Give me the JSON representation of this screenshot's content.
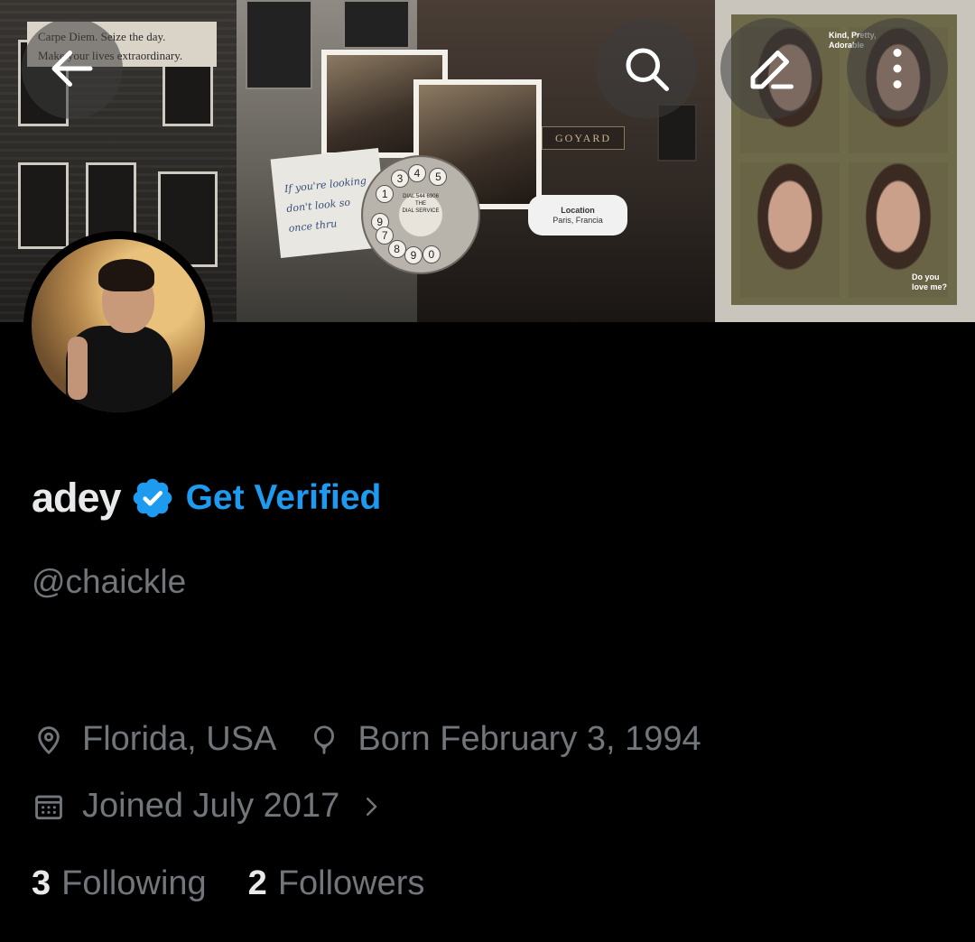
{
  "header": {
    "back_icon": "arrow-left-icon",
    "search_icon": "search-icon",
    "edit_icon": "pencil-icon",
    "more_icon": "more-vertical-icon"
  },
  "banner": {
    "quote_line1": "Carpe Diem. Seize the day.",
    "quote_line2": "Make your lives extraordinary.",
    "note_line1": "If you're looking",
    "note_line2": "don't look so",
    "note_line3": "once thru",
    "dial_text1": "DIAL 544 6906",
    "dial_text2": "THE",
    "dial_text3": "DIAL SERVICE",
    "dial_numbers": [
      "1",
      "3",
      "4",
      "5",
      "9",
      "7",
      "8",
      "9",
      "0"
    ],
    "store_sign": "GOYARD",
    "location_title": "Location",
    "location_value": "Paris, Francia",
    "collage_text_top": "Kind, Pretty, Adorable",
    "collage_text_bottom": "Do you love me?"
  },
  "profile": {
    "display_name": "adey",
    "verified_badge_icon": "verified-badge-icon",
    "verified_color": "#1d9bf0",
    "get_verified_label": "Get Verified",
    "handle": "@chaickle",
    "location": "Florida, USA",
    "birthday": "Born February 3, 1994",
    "joined": "Joined July 2017",
    "following_count": "3",
    "following_label": "Following",
    "followers_count": "2",
    "followers_label": "Followers"
  }
}
